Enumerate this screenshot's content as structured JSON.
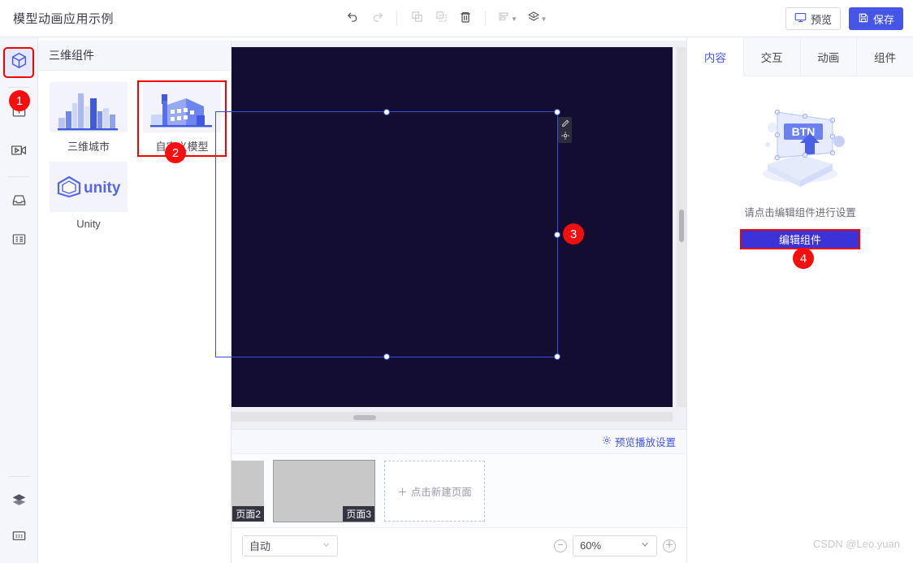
{
  "header": {
    "title": "模型动画应用示例",
    "toolbar": [
      {
        "name": "undo",
        "icon": "undo-icon",
        "state": "enabled"
      },
      {
        "name": "redo",
        "icon": "redo-icon",
        "state": "disabled"
      },
      {
        "name": "copy",
        "icon": "copy-icon",
        "state": "disabled"
      },
      {
        "name": "paste",
        "icon": "paste-icon",
        "state": "disabled"
      },
      {
        "name": "delete",
        "icon": "trash-icon",
        "state": "enabled"
      },
      {
        "name": "align",
        "icon": "align-icon",
        "state": "disabled"
      },
      {
        "name": "layers",
        "icon": "stack-icon",
        "state": "enabled"
      }
    ],
    "preview_label": "预览",
    "save_label": "保存",
    "accent": "#4455e8"
  },
  "rail": {
    "items": [
      {
        "label": "三维组件",
        "icon": "cube-icon",
        "active": true,
        "highlighted": true
      },
      {
        "label": "文本组件",
        "icon": "text-box-icon",
        "active": false
      },
      {
        "label": "媒体组件",
        "icon": "video-icon",
        "active": false
      },
      {
        "label": "容器组件",
        "icon": "tray-icon",
        "active": false
      },
      {
        "label": "数据组件",
        "icon": "list-panel-icon",
        "active": false
      }
    ],
    "bottom_items": [
      {
        "label": "图层",
        "icon": "layers-icon"
      },
      {
        "label": "页面面板",
        "icon": "panel-icon"
      }
    ]
  },
  "library": {
    "title": "三维组件",
    "items": [
      {
        "label": "三维城市",
        "icon": "city-skyline-icon",
        "highlighted": false
      },
      {
        "label": "自定义模型",
        "icon": "factory-icon",
        "highlighted": true
      },
      {
        "label": "Unity",
        "icon": "unity-logo-icon",
        "highlighted": false
      }
    ]
  },
  "canvas": {
    "background": "#120d31",
    "selection": {
      "mini_tools": [
        {
          "icon": "pencil-icon"
        },
        {
          "icon": "target-icon"
        }
      ]
    }
  },
  "bottom": {
    "preview_settings_label": "预览播放设置",
    "pages": [
      {
        "label": "页面2",
        "selected": false
      },
      {
        "label": "页面3",
        "selected": true
      }
    ],
    "new_page_label": "点击新建页面",
    "new_page_plus": "＋",
    "fit_mode": "自动",
    "zoom_value": "60%",
    "zoom_out": "−",
    "zoom_in": "＋"
  },
  "right": {
    "tabs": [
      {
        "label": "内容",
        "active": true
      },
      {
        "label": "交互",
        "active": false
      },
      {
        "label": "动画",
        "active": false
      },
      {
        "label": "组件",
        "active": false
      }
    ],
    "empty_illustration_text": "BTN",
    "empty_hint": "请点击编辑组件进行设置",
    "edit_component_label": "编辑组件"
  },
  "steps": [
    {
      "number": "1"
    },
    {
      "number": "2"
    },
    {
      "number": "3"
    },
    {
      "number": "4"
    }
  ],
  "watermark": "CSDN @Leo.yuan"
}
